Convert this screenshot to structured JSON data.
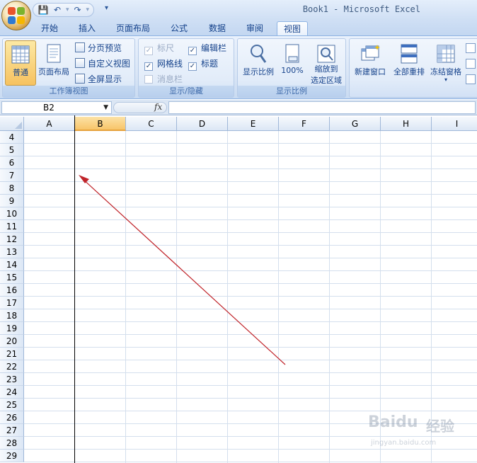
{
  "window": {
    "title": "Book1 - Microsoft Excel"
  },
  "quick_access": {
    "save_icon": "save-icon",
    "undo_icon": "undo-icon",
    "redo_icon": "redo-icon",
    "customize_icon": "customize-qat-icon"
  },
  "tabs": [
    {
      "label": "开始"
    },
    {
      "label": "插入"
    },
    {
      "label": "页面布局"
    },
    {
      "label": "公式"
    },
    {
      "label": "数据"
    },
    {
      "label": "审阅"
    },
    {
      "label": "视图",
      "active": true
    }
  ],
  "ribbon": {
    "workbook_views": {
      "label": "工作簿视图",
      "normal": "普通",
      "page_layout": "页面布局",
      "page_break_preview": "分页预览",
      "custom_views": "自定义视图",
      "full_screen": "全屏显示"
    },
    "show_hide": {
      "label": "显示/隐藏",
      "ruler": {
        "label": "标尺",
        "checked": true,
        "disabled": true
      },
      "formula_bar": {
        "label": "编辑栏",
        "checked": true
      },
      "gridlines": {
        "label": "网格线",
        "checked": true
      },
      "headings": {
        "label": "标题",
        "checked": true
      },
      "message_bar": {
        "label": "消息栏",
        "checked": false,
        "disabled": true
      }
    },
    "zoom": {
      "label": "显示比例",
      "zoom": "显示比例",
      "zoom_100": "100%",
      "zoom_selection_line1": "缩放到",
      "zoom_selection_line2": "选定区域"
    },
    "window_group": {
      "new_window": "新建窗口",
      "arrange_all": "全部重排",
      "freeze_panes": "冻结窗格"
    }
  },
  "formula_bar": {
    "name_box": "B2",
    "fx": "fx",
    "formula": ""
  },
  "columns": [
    "A",
    "B",
    "C",
    "D",
    "E",
    "F",
    "G",
    "H",
    "I"
  ],
  "selected_column": "B",
  "rows": [
    "4",
    "5",
    "6",
    "7",
    "8",
    "9",
    "10",
    "11",
    "12",
    "13",
    "14",
    "15",
    "16",
    "17",
    "18",
    "19",
    "20",
    "21",
    "22",
    "23",
    "24",
    "25",
    "26",
    "27",
    "28",
    "29"
  ],
  "annotation": {
    "color": "#c0242a"
  },
  "watermark": {
    "brand": "Baidu",
    "brand_cn": "经验",
    "url": "jingyan.baidu.com"
  }
}
